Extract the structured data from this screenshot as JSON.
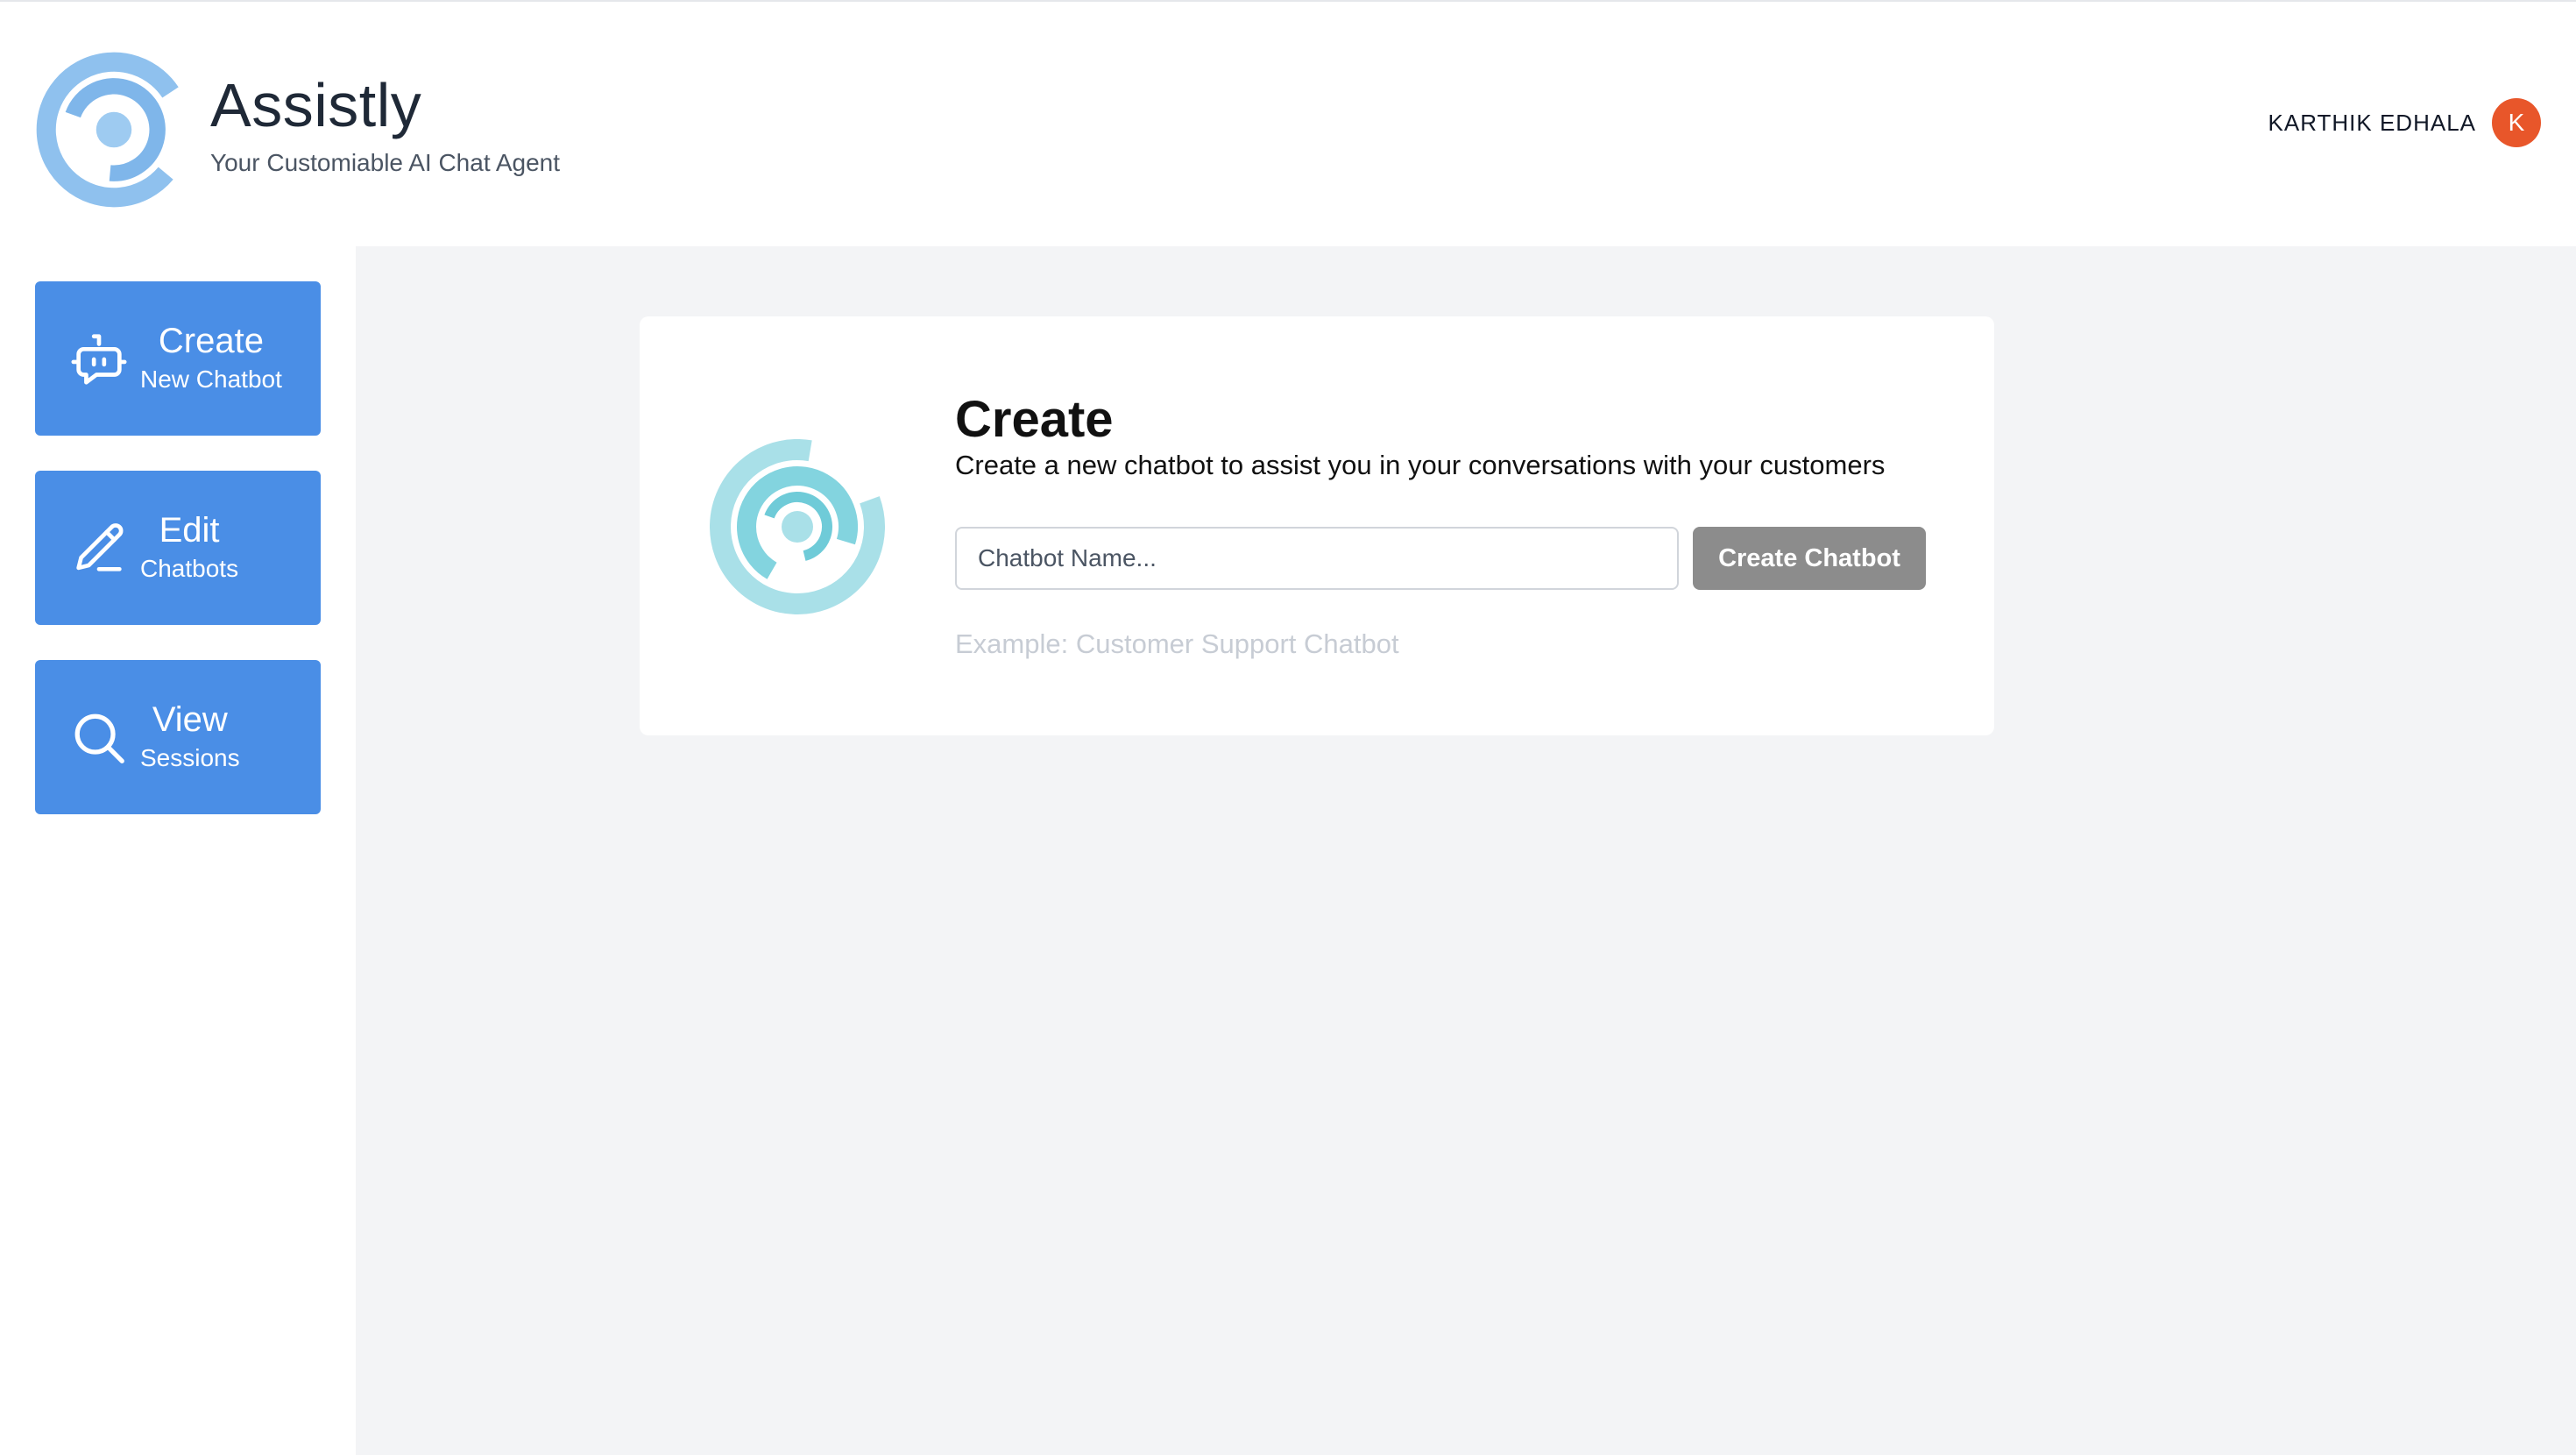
{
  "header": {
    "brand_name": "Assistly",
    "tagline": "Your Customiable AI Chat Agent",
    "user_name": "KARTHIK EDHALA",
    "avatar_initial": "K"
  },
  "sidebar": {
    "items": [
      {
        "title": "Create",
        "subtitle": "New Chatbot",
        "icon": "bot-message-icon"
      },
      {
        "title": "Edit",
        "subtitle": "Chatbots",
        "icon": "pencil-icon"
      },
      {
        "title": "View",
        "subtitle": "Sessions",
        "icon": "search-icon"
      }
    ]
  },
  "main": {
    "title": "Create",
    "description": "Create a new chatbot to assist you in your conversations with your customers",
    "input_placeholder": "Chatbot Name...",
    "input_value": "",
    "button_label": "Create Chatbot",
    "example": "Example: Customer Support Chatbot"
  },
  "colors": {
    "accent": "#4a8ee6",
    "avatar": "#e8562a",
    "button_disabled": "#8c8c8c",
    "background": "#f3f4f6",
    "logo_header": "#8fc1ee",
    "logo_card": "#7ed3df"
  }
}
